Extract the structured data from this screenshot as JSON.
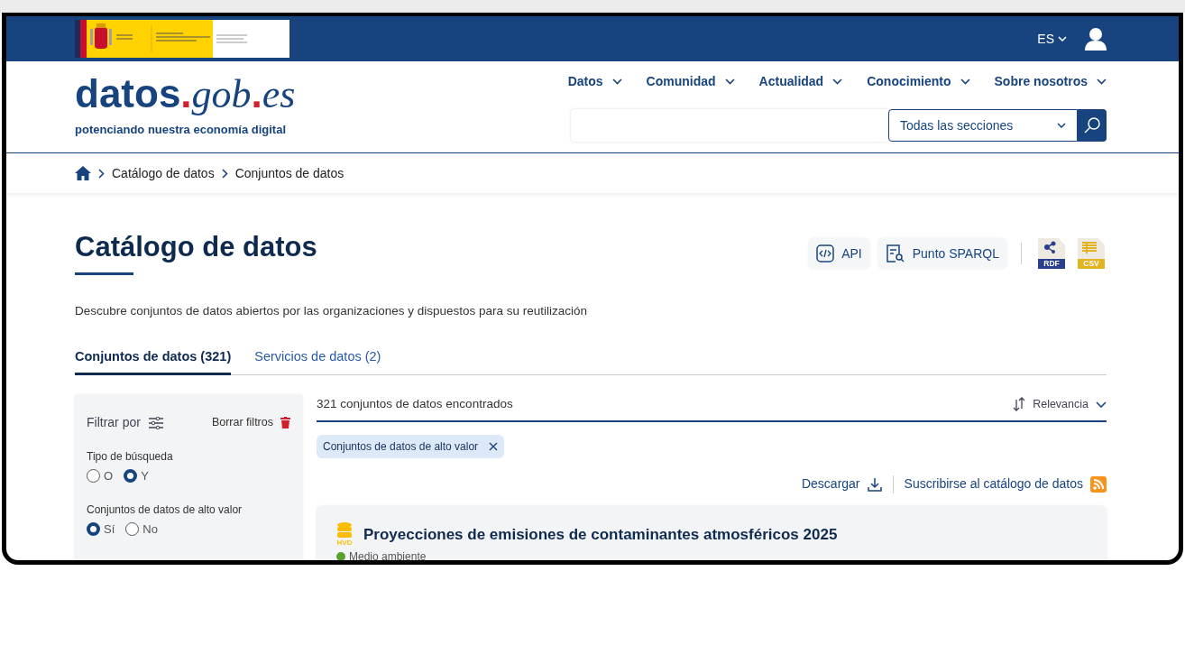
{
  "top_bar": {
    "language": "ES"
  },
  "logo": {
    "segments": [
      {
        "kind": "sans",
        "text": "datos"
      },
      {
        "kind": "dot",
        "text": "."
      },
      {
        "kind": "serif",
        "text": "gob"
      },
      {
        "kind": "dot",
        "text": "."
      },
      {
        "kind": "serif",
        "text": "es"
      }
    ],
    "tagline": "potenciando nuestra economía digital"
  },
  "nav": [
    "Datos",
    "Comunidad",
    "Actualidad",
    "Conocimiento",
    "Sobre nosotros"
  ],
  "search": {
    "scope": "Todas las secciones"
  },
  "breadcrumb": [
    "Catálogo de datos",
    "Conjuntos de datos"
  ],
  "page": {
    "title": "Catálogo de datos",
    "description": "Descubre conjuntos de datos abiertos por las organizaciones y dispuestos para su reutilización"
  },
  "actions": [
    {
      "kind": "api",
      "label": "API"
    },
    {
      "kind": "sparql",
      "label": "Punto SPARQL"
    }
  ],
  "formats": [
    {
      "kind": "rdf",
      "label": "RDF",
      "color": "#2b3f8f"
    },
    {
      "kind": "csv",
      "label": "CSV",
      "color": "#e3b422"
    }
  ],
  "tabs": [
    {
      "label": "Conjuntos de datos (321)",
      "selected": true
    },
    {
      "label": "Servicios de datos (2)",
      "selected": false
    }
  ],
  "filters": {
    "title": "Filtrar por",
    "clear": "Borrar filtros",
    "groups": [
      {
        "label": "Tipo de búsqueda",
        "options": [
          {
            "label": "O",
            "selected": false
          },
          {
            "label": "Y",
            "selected": true
          }
        ]
      },
      {
        "label": "Conjuntos de datos de alto valor",
        "options": [
          {
            "label": "Sí",
            "selected": true
          },
          {
            "label": "No",
            "selected": false
          }
        ]
      }
    ]
  },
  "results": {
    "count": "321 conjuntos de datos encontrados",
    "sort": "Relevancia",
    "active_filters": [
      "Conjuntos de datos de alto valor"
    ],
    "download": "Descargar",
    "subscribe": "Suscribirse al catálogo de datos",
    "items": [
      {
        "badge": "HVD",
        "title": "Proyecciones de emisiones de contaminantes atmosféricos 2025",
        "category": {
          "label": "Medio ambiente",
          "color": "#5aa02c"
        }
      }
    ]
  }
}
